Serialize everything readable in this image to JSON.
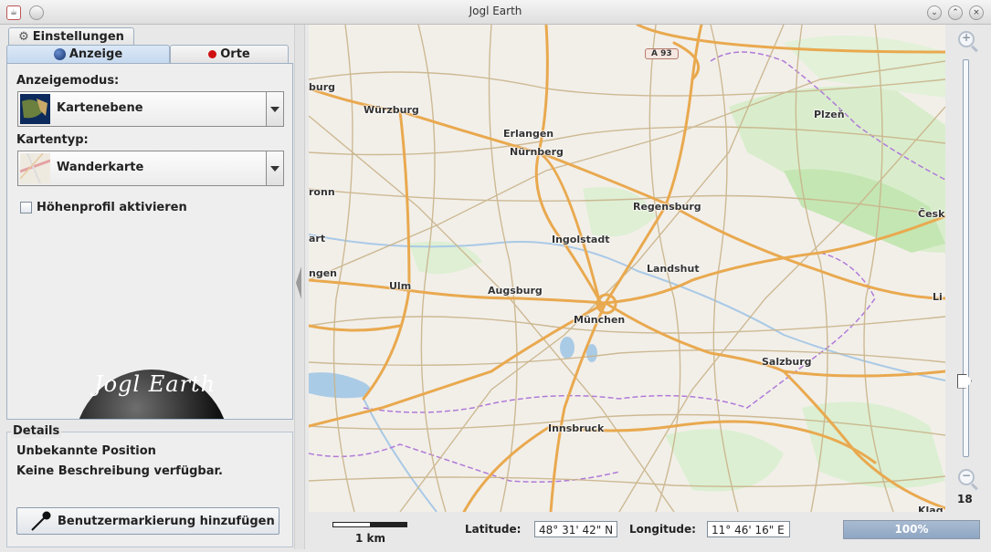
{
  "window": {
    "title": "Jogl Earth"
  },
  "tabs": {
    "settings": "Einstellungen",
    "display": "Anzeige",
    "places": "Orte"
  },
  "display": {
    "mode_label": "Anzeigemodus:",
    "mode_value": "Kartenebene",
    "maptype_label": "Kartentyp:",
    "maptype_value": "Wanderkarte",
    "elevation_checkbox": "Höhenprofil aktivieren",
    "elevation_checked": false,
    "logo_text": "Jogl Earth"
  },
  "details": {
    "legend": "Details",
    "position": "Unbekannte Position",
    "description": "Keine Beschreibung verfügbar.",
    "add_marker_button": "Benutzermarkierung hinzufügen"
  },
  "map": {
    "road_shield": "A 93",
    "cities": [
      {
        "name": "Würzburg"
      },
      {
        "name": "Erlangen"
      },
      {
        "name": "Nürnberg"
      },
      {
        "name": "Plzeň"
      },
      {
        "name": "Regensburg"
      },
      {
        "name": "Ingolstadt"
      },
      {
        "name": "Landshut"
      },
      {
        "name": "Ulm"
      },
      {
        "name": "Augsburg"
      },
      {
        "name": "München"
      },
      {
        "name": "Salzburg"
      },
      {
        "name": "Innsbruck"
      },
      {
        "name": "burg"
      },
      {
        "name": "ronn"
      },
      {
        "name": "art"
      },
      {
        "name": "ngen"
      },
      {
        "name": "Česk"
      },
      {
        "name": "Li"
      },
      {
        "name": "Klag"
      }
    ]
  },
  "zoom": {
    "level": "18",
    "slider_fraction": 0.19
  },
  "status": {
    "scale_label": "1 km",
    "latitude_label": "Latitude:",
    "latitude_value": "48° 31' 42\" N",
    "longitude_label": "Longitude:",
    "longitude_value": "11° 46' 16\" E",
    "progress_text": "100%",
    "progress_fraction": 1.0
  },
  "colors": {
    "map_background": "#f2efe9",
    "major_road": "#e9a94f",
    "minor_road": "#c9b48a",
    "forest": "#d4ecc8",
    "water": "#aacbe6",
    "border": "#b07ad8",
    "accent": "#c6d9ef"
  }
}
